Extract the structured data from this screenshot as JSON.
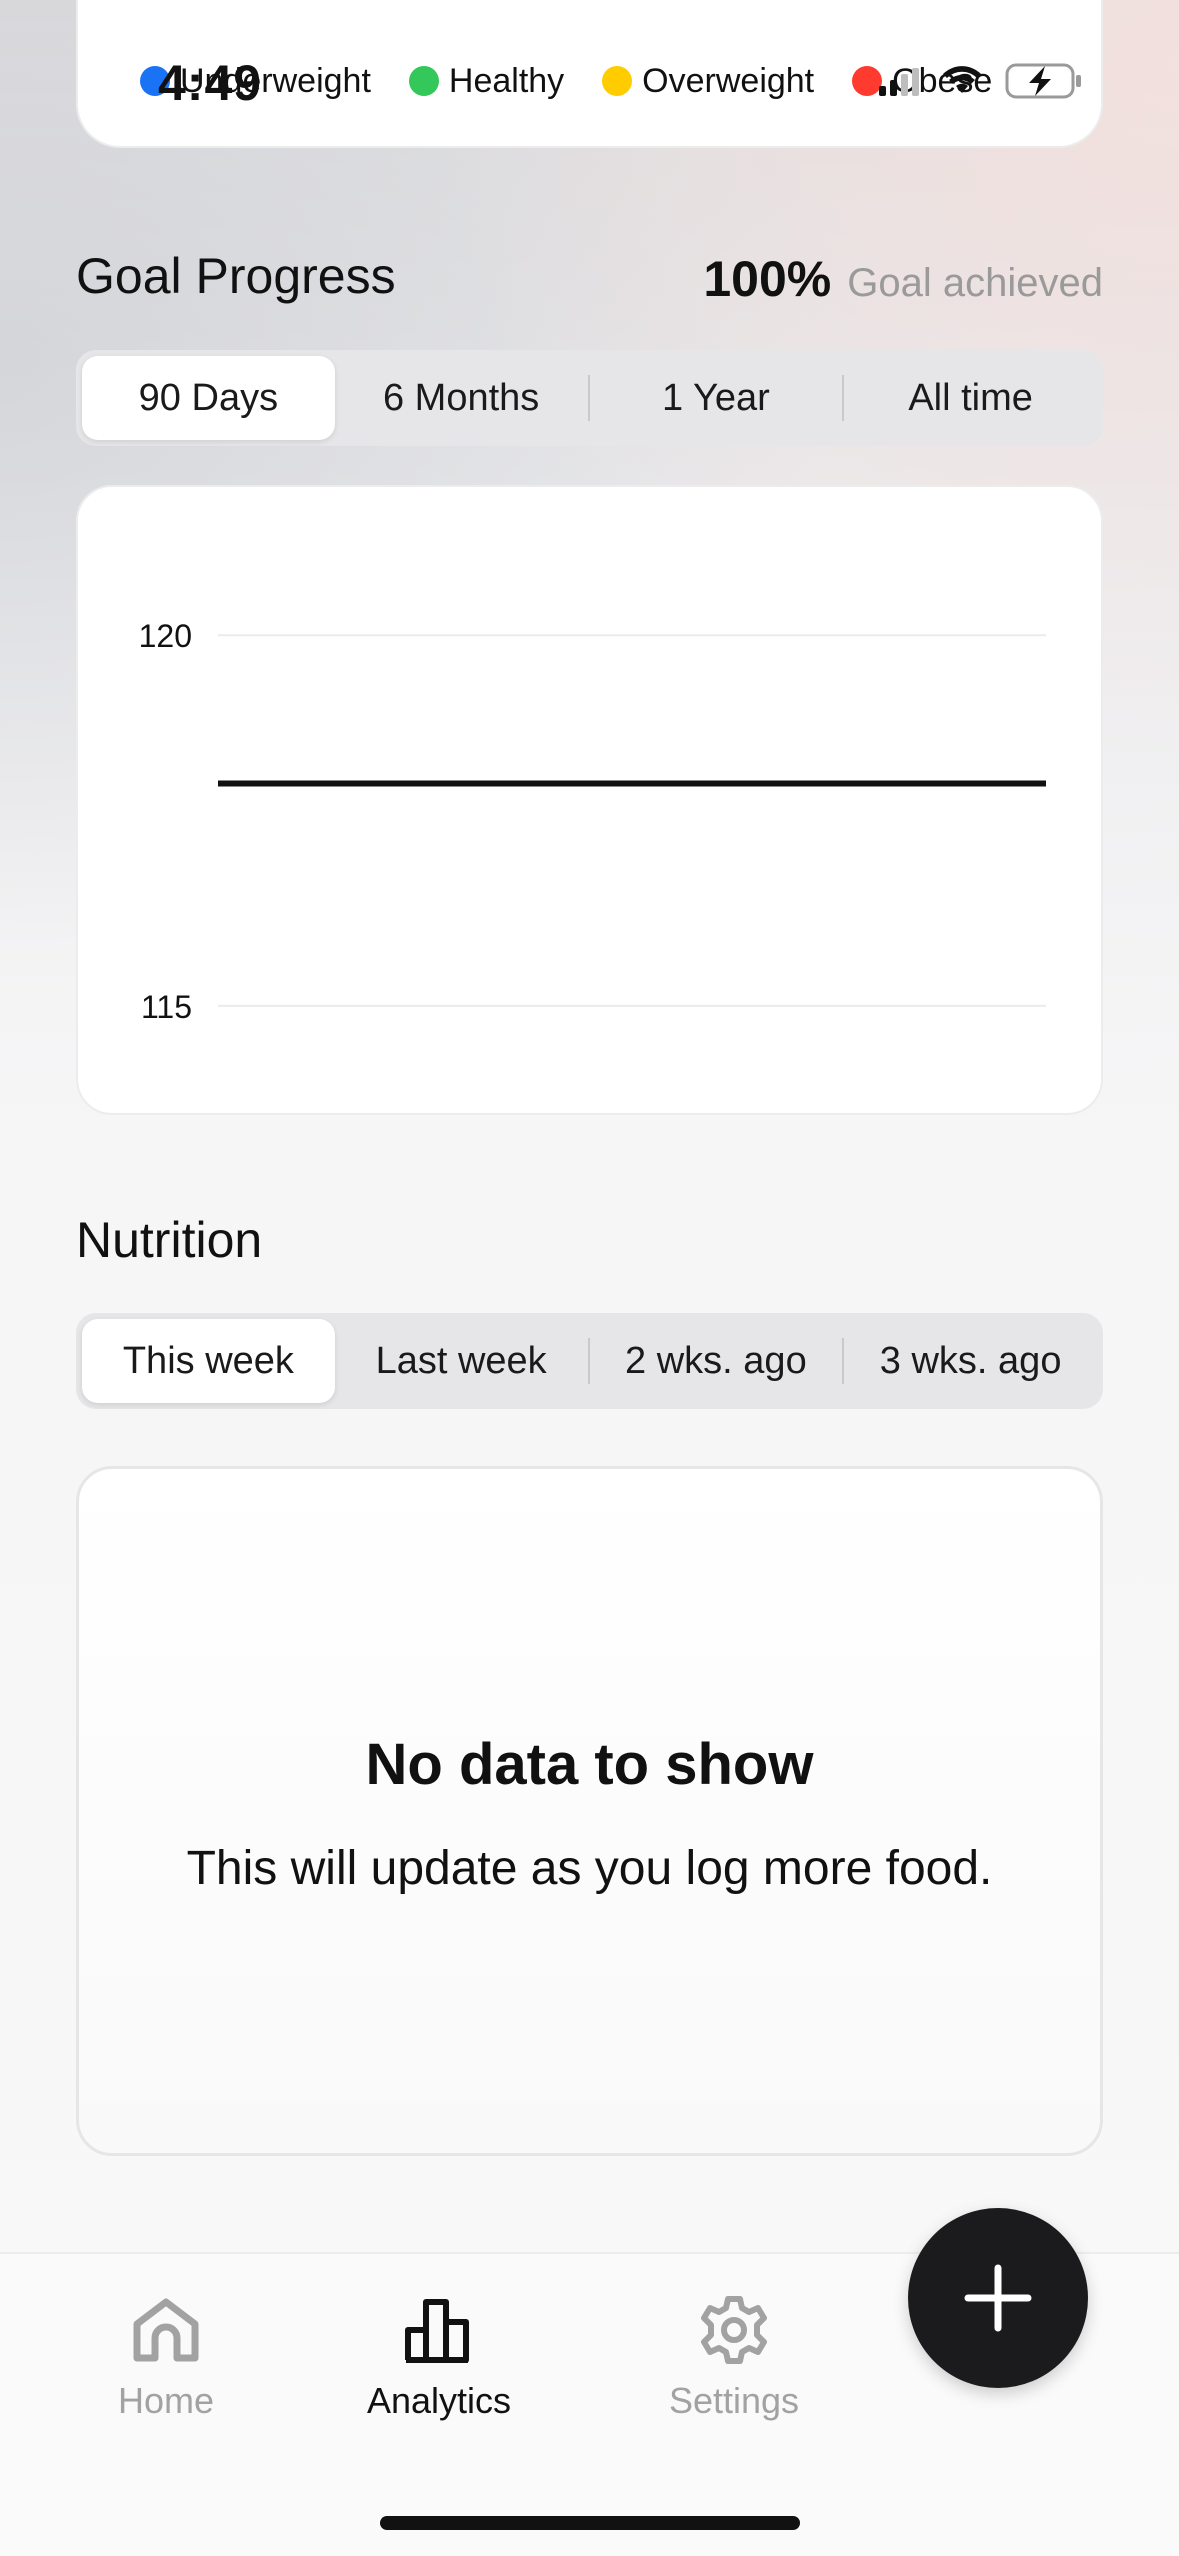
{
  "status_bar": {
    "time": "4:49"
  },
  "bmi_legend": {
    "items": [
      {
        "label": "Underweight",
        "color": "#1a73f5"
      },
      {
        "label": "Healthy",
        "color": "#34c759"
      },
      {
        "label": "Overweight",
        "color": "#ffcc00"
      },
      {
        "label": "Obese",
        "color": "#ff3b30"
      }
    ]
  },
  "goal_progress": {
    "title": "Goal Progress",
    "percent": "100%",
    "status": "Goal achieved",
    "tabs": [
      {
        "label": "90 Days",
        "active": true
      },
      {
        "label": "6 Months",
        "active": false
      },
      {
        "label": "1 Year",
        "active": false
      },
      {
        "label": "All time",
        "active": false
      }
    ]
  },
  "chart_data": {
    "type": "line",
    "title": "",
    "xlabel": "",
    "ylabel": "",
    "ylim": [
      113.5,
      122
    ],
    "yticks": [
      120,
      115
    ],
    "grid": true,
    "series": [
      {
        "values": [
          118,
          118
        ]
      }
    ]
  },
  "nutrition": {
    "title": "Nutrition",
    "tabs": [
      {
        "label": "This week",
        "active": true
      },
      {
        "label": "Last week",
        "active": false
      },
      {
        "label": "2 wks. ago",
        "active": false
      },
      {
        "label": "3 wks. ago",
        "active": false
      }
    ],
    "empty_title": "No data to show",
    "empty_subtitle": "This will update as you log more food."
  },
  "tabbar": {
    "items": [
      {
        "label": "Home",
        "icon": "home-icon",
        "active": false
      },
      {
        "label": "Analytics",
        "icon": "analytics-icon",
        "active": true
      },
      {
        "label": "Settings",
        "icon": "gear-icon",
        "active": false
      }
    ],
    "fab_icon": "plus-icon"
  },
  "colors": {
    "accent_dark": "#1b1b1d",
    "inactive_gray": "#a2a2a2"
  }
}
